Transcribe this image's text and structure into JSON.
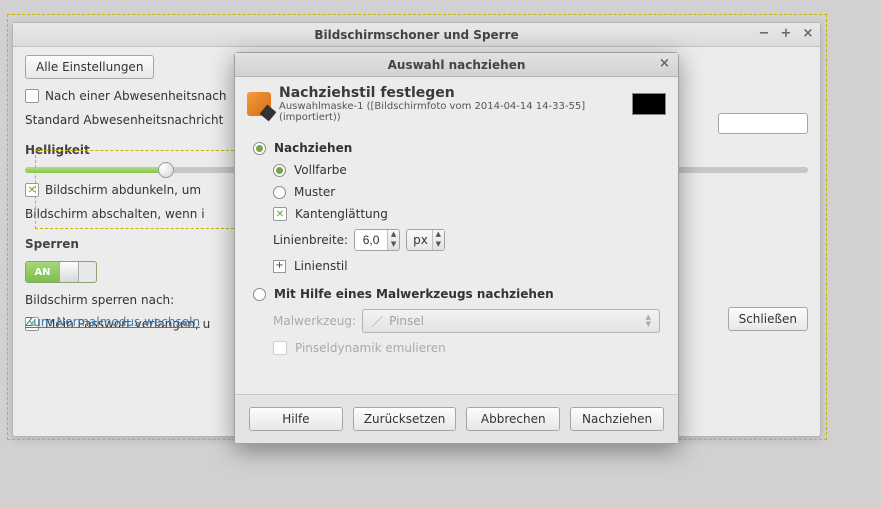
{
  "bg_window": {
    "title": "Bildschirmschoner und Sperre",
    "all_settings_btn": "Alle Einstellungen",
    "after_away_checkbox_label": "Nach einer Abwesenheitsnach",
    "default_away_label": "Standard Abwesenheitsnachricht",
    "section_brightness": "Helligkeit",
    "dim_screen_checkbox_label": "Bildschirm abdunkeln, um",
    "screen_off_label": "Bildschirm abschalten, wenn i",
    "section_lock": "Sperren",
    "toggle_on": "AN",
    "lock_after_label": "Bildschirm sperren nach:",
    "require_pw_label": "Mein Passwort verlangen, u",
    "normal_mode_link": "Zum Normalmodus wechseln",
    "close_btn": "Schließen"
  },
  "dialog": {
    "titlebar": "Auswahl nachziehen",
    "heading": "Nachziehstil festlegen",
    "subtitle": "Auswahlmaske-1 ([Bildschirmfoto vom 2014-04-14 14-33-55] (importiert))",
    "grp_trace": "Nachziehen",
    "opt_solid": "Vollfarbe",
    "opt_pattern": "Muster",
    "chk_antialias": "Kantenglättung",
    "lbl_linewidth": "Linienbreite:",
    "linewidth_value": "6,0",
    "linewidth_unit": "px",
    "expander_linestyle": "Linienstil",
    "grp_painttool": "Mit Hilfe eines Malwerkzeugs nachziehen",
    "lbl_painttool": "Malwerkzeug:",
    "painttool_value": "Pinsel",
    "chk_brushdyn": "Pinseldynamik emulieren",
    "btn_help": "Hilfe",
    "btn_reset": "Zurücksetzen",
    "btn_cancel": "Abbrechen",
    "btn_ok": "Nachziehen"
  }
}
